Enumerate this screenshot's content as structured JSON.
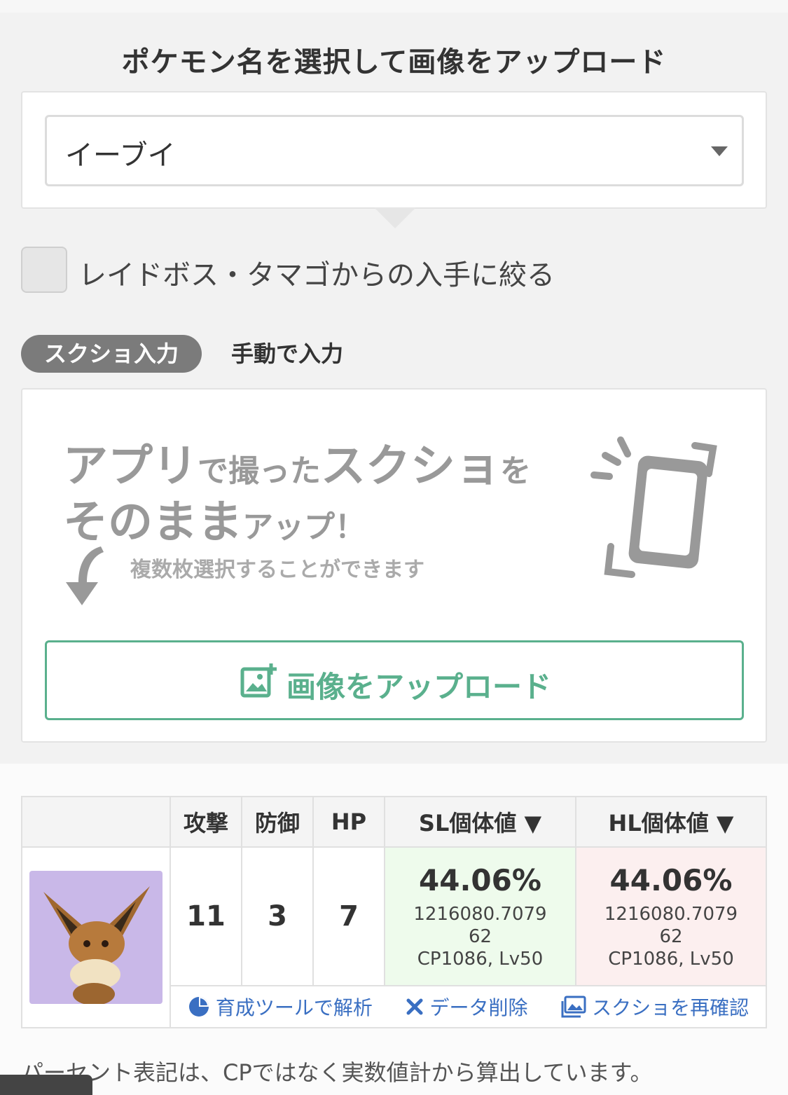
{
  "header": {
    "title": "ポケモン名を選択して画像をアップロード"
  },
  "pokemon_select": {
    "selected": "イーブイ"
  },
  "filter": {
    "label": "レイドボス・タマゴからの入手に絞る",
    "checked": false
  },
  "input_tabs": [
    {
      "label": "スクショ入力",
      "active": true
    },
    {
      "label": "手動で入力",
      "active": false
    }
  ],
  "upload_promo": {
    "line1_big_a": "アプリ",
    "line1_small_a": "で撮った",
    "line1_big_b": "スクショ",
    "line1_small_b": "を",
    "line2_big": "そのまま",
    "line2_small": "アップ！",
    "sub": "複数枚選択することができます",
    "button_label": "画像をアップロード"
  },
  "result_table": {
    "headers": [
      "",
      "攻撃",
      "防御",
      "HP",
      "SL個体値 ▼",
      "HL個体値 ▼"
    ],
    "row": {
      "attack": "11",
      "defense": "3",
      "hp": "7",
      "sl": {
        "percent": "44.06%",
        "line1": "1216080.7079",
        "line2": "62",
        "line3": "CP1086, Lv50"
      },
      "hl": {
        "percent": "44.06%",
        "line1": "1216080.7079",
        "line2": "62",
        "line3": "CP1086, Lv50"
      }
    },
    "actions": [
      {
        "label": "育成ツールで解析",
        "icon": "pie-chart-icon"
      },
      {
        "label": "データ削除",
        "icon": "close-icon"
      },
      {
        "label": "スクショを再確認",
        "icon": "image-icon"
      }
    ]
  },
  "footnote": "パーセント表記は、CPではなく実数値計から算出しています。",
  "colors": {
    "accent_green": "#5ab08d",
    "link_blue": "#3a6fc2",
    "sl_bg": "#eefbec",
    "hl_bg": "#fcefef"
  }
}
